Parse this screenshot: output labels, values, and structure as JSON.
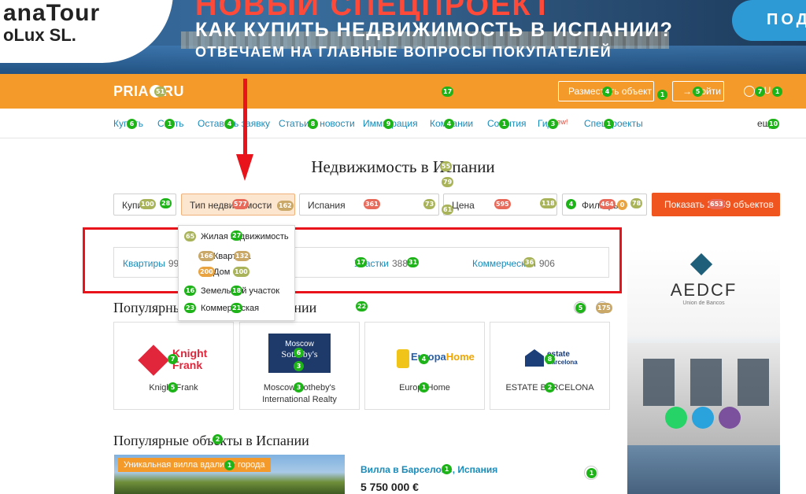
{
  "banner": {
    "brand_line1": "anaTour",
    "brand_line2": "oLux SL.",
    "headline_top": "НОВЫЙ СПЕЦПРОЕКТ",
    "headline": "КАК КУПИТЬ НЕДВИЖИМОСТЬ В ИСПАНИИ?",
    "subheadline": "ОТВЕЧАЕМ НА ГЛАВНЫЕ ВОПРОСЫ ПОКУПАТЕЛЕЙ",
    "cta": "ПОД"
  },
  "header": {
    "logo_left": "PRIA",
    "logo_right": "RU",
    "place_ad_label": "Разместить объект",
    "login_label": "→ Войти",
    "lang_label": "RU"
  },
  "nav": {
    "items": [
      "Купить",
      "Снять",
      "Оставить заявку",
      "Статьи и новости",
      "Иммиграция",
      "Компании",
      "События",
      "Гид",
      "Спецпроекты"
    ],
    "new_badge": "new!",
    "more_label": "ещё"
  },
  "page": {
    "title": "Недвижимость в Испании"
  },
  "search": {
    "deal_value": "Купить",
    "type_value": "Тип недвижимости",
    "location_value": "Испания",
    "price_placeholder": "Цена",
    "filters_label": "Фильтры",
    "show_button": "Показать 2 559 объектов"
  },
  "categories": [
    {
      "label": "Квартиры",
      "count": "99"
    },
    {
      "label": "Участки",
      "count": "388"
    },
    {
      "label": "Коммерческая",
      "count": "906"
    }
  ],
  "dropdown": {
    "residential": "Жилая недвижимость",
    "apartment": "Квартира",
    "house": "Дом",
    "land": "Земельный участок",
    "commercial": "Коммерческая"
  },
  "agencies_section": {
    "title": "Популярные агентства в Испании",
    "items": [
      {
        "name": "Knight Frank",
        "logo_text1": "Knight",
        "logo_text2": "Frank",
        "color": "#e1263b"
      },
      {
        "name": "Moscow Sotheby's International Realty",
        "logo_text1": "Moscow",
        "logo_text2": "Sotheby's",
        "color": "#1d3a6b"
      },
      {
        "name": "EuropaHome",
        "logo_text1": "Europa",
        "logo_text2": "Home",
        "color": "#2a5fa8"
      },
      {
        "name": "ESTATE BARCELONA",
        "logo_text1": "estate",
        "logo_text2": "Barcelona",
        "color": "#1c3f7a"
      }
    ]
  },
  "side_ad": {
    "brand": "AEDCF",
    "tagline": "Union de Bancos"
  },
  "listings_section": {
    "title": "Популярные объекты в Испании",
    "badge": "Уникальная вилла вдали от города",
    "listing_title": "Вилла в Барселоне, Испания",
    "price": "5 750 000 €"
  },
  "colors": {
    "header_orange": "#f39a2b",
    "link_blue": "#1a8bb9",
    "cta_red": "#f0551f",
    "annotation_red": "#e8131b"
  }
}
